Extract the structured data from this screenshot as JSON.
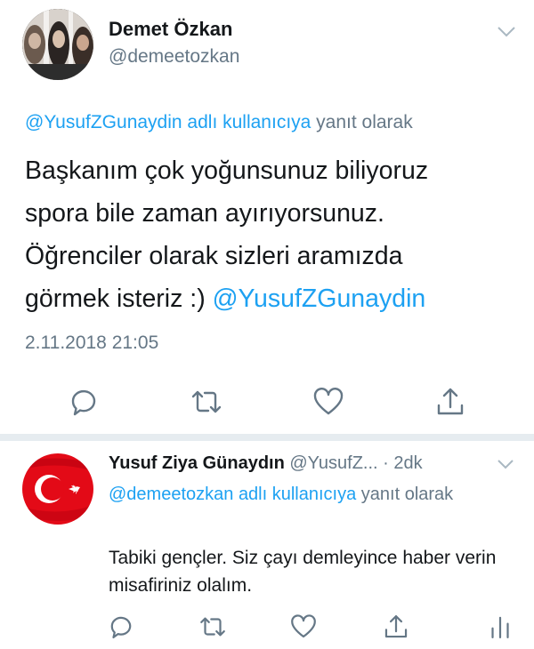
{
  "main_tweet": {
    "author_name": "Demet Özkan",
    "author_handle": "@demeetozkan",
    "reply_to_handle": "@YusufZGunaydin adlı kullanıcıya",
    "reply_to_suffix": " yanıt olarak",
    "text_lines": [
      "Başkanım çok yoğunsunuz biliyoruz",
      "spora bile zaman ayırıyorsunuz.",
      "Öğrenciler olarak sizleri aramızda"
    ],
    "text_last_line_prefix": "görmek isteriz :) ",
    "text_last_line_mention": "@YusufZGunaydin",
    "timestamp": "2.11.2018 21:05",
    "icons": [
      "reply-icon",
      "retweet-icon",
      "like-icon",
      "share-icon"
    ]
  },
  "reply_tweet": {
    "author_name": "Yusuf Ziya Günaydın",
    "author_handle_truncated": "@YusufZ...",
    "time_ago": " · 2dk",
    "reply_to_handle": "@demeetozkan adlı kullanıcıya",
    "reply_to_suffix": " yanıt olarak",
    "text": "Tabiki gençler. Siz çayı demleyince haber verin misafiriniz olalım.",
    "icons": [
      "reply-icon",
      "retweet-icon",
      "like-icon",
      "share-icon",
      "analytics-icon"
    ]
  },
  "colors": {
    "link": "#1da1f2",
    "muted": "#657786",
    "text": "#14171a",
    "divider": "#e6ecf0",
    "flag_red": "#e30a17"
  }
}
